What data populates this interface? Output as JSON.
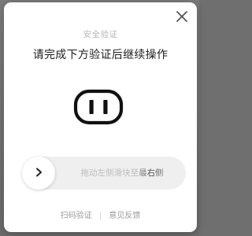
{
  "dialog": {
    "subtitle": "安全验证",
    "title": "请完成下方验证后继续操作",
    "close_icon": "close-icon"
  },
  "captcha": {
    "image_icon": "outlet-face-icon",
    "slider_hint": "拖动左侧滑块至最右侧",
    "handle_icon": "chevron-right-icon"
  },
  "footer": {
    "scan_label": "扫码验证",
    "separator": "|",
    "feedback_label": "意见反馈"
  },
  "colors": {
    "modal_bg": "#ffffff",
    "track_bg": "#efefef",
    "title": "#1d1d1d",
    "muted": "#b5b5b5"
  }
}
